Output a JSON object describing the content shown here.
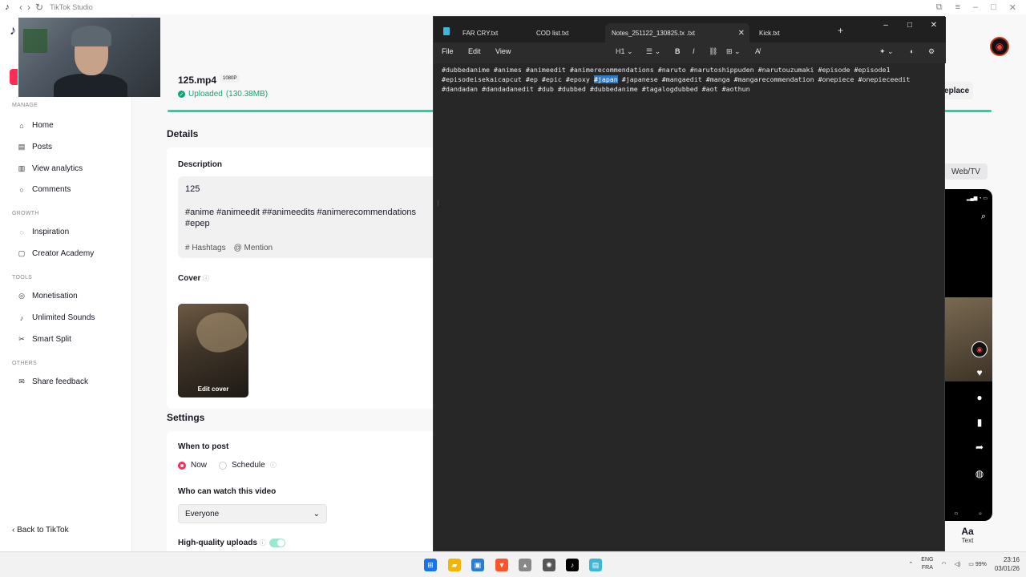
{
  "browser": {
    "title": "TikTok Studio",
    "nav_back": "‹",
    "nav_forward": "›",
    "nav_reload": "↻"
  },
  "sidebar": {
    "logo": "♪",
    "sections": [
      {
        "title": "MANAGE",
        "items": [
          {
            "label": "Home",
            "icon": "home-icon"
          },
          {
            "label": "Posts",
            "icon": "posts-icon"
          },
          {
            "label": "View analytics",
            "icon": "analytics-icon"
          },
          {
            "label": "Comments",
            "icon": "comments-icon"
          }
        ]
      },
      {
        "title": "GROWTH",
        "items": [
          {
            "label": "Inspiration",
            "icon": "lightbulb-icon"
          },
          {
            "label": "Creator Academy",
            "icon": "academy-icon"
          }
        ]
      },
      {
        "title": "TOOLS",
        "items": [
          {
            "label": "Monetisation",
            "icon": "monetisation-icon"
          },
          {
            "label": "Unlimited Sounds",
            "icon": "music-note-icon"
          },
          {
            "label": "Smart Split",
            "icon": "split-icon"
          }
        ]
      },
      {
        "title": "OTHERS",
        "items": [
          {
            "label": "Share feedback",
            "icon": "feedback-icon"
          }
        ]
      }
    ],
    "back_label": "‹  Back to TikTok"
  },
  "upload": {
    "file_name": "125.mp4",
    "resolution": "1080P",
    "status": "Uploaded",
    "size": "(130.38MB)",
    "progress_fraction": 1.0,
    "replace_label": "Replace"
  },
  "details": {
    "heading": "Details",
    "description_label": "Description",
    "description_title": "125",
    "description_tags_line1": "#anime  #animeedit  ##animeedits  #animerecommendations",
    "description_tags_line2": "#epep",
    "hashtags_label": "# Hashtags",
    "mention_label": "@ Mention",
    "cover_label": "Cover",
    "edit_cover_label": "Edit cover"
  },
  "settings": {
    "heading": "Settings",
    "when_to_post_label": "When to post",
    "now_label": "Now",
    "schedule_label": "Schedule",
    "who_can_watch_label": "Who can watch this video",
    "who_can_watch_value": "Everyone",
    "hq_uploads_label": "High-quality uploads",
    "hq_uploads_on": true
  },
  "preview": {
    "web_tv_label": "Web/TV",
    "text_tool_label": "Text",
    "text_tool_glyph": "Aa"
  },
  "notepad": {
    "tabs": [
      {
        "label": "FAR CRY.txt",
        "active": false
      },
      {
        "label": "COD list.txt",
        "active": false
      },
      {
        "label": "Notes_251122_130825.tx",
        "active": false
      },
      {
        "label": ".txt",
        "active": true
      },
      {
        "label": "Kick.txt",
        "active": false
      }
    ],
    "menu": [
      "File",
      "Edit",
      "View"
    ],
    "heading_select": "H1",
    "text_line1": "#dubbedanime #animes #animeedit #animerecommendations #naruto #narutoshippuden #narutouzumaki #episode #episode1",
    "text_line2_before": "#episodeisekaicapcut #ep #epic #epoxy ",
    "text_line2_selected": "#japan",
    "text_line2_after": " #japanese #mangaedit #manga #mangarecommendation #onepiece #onepieceedit",
    "text_line3": "#dandadan #dandadanedit #dub #dubbed #dubbedanime #tagalogdubbed #aot #aothun"
  },
  "taskbar": {
    "lang_top": "ENG",
    "lang_bottom": "FRA",
    "battery": "99%",
    "time": "23:16",
    "date": "03/01/26"
  },
  "colors": {
    "accent": "#fe2c55",
    "success": "#0ca678",
    "selection": "#2f78c4"
  }
}
